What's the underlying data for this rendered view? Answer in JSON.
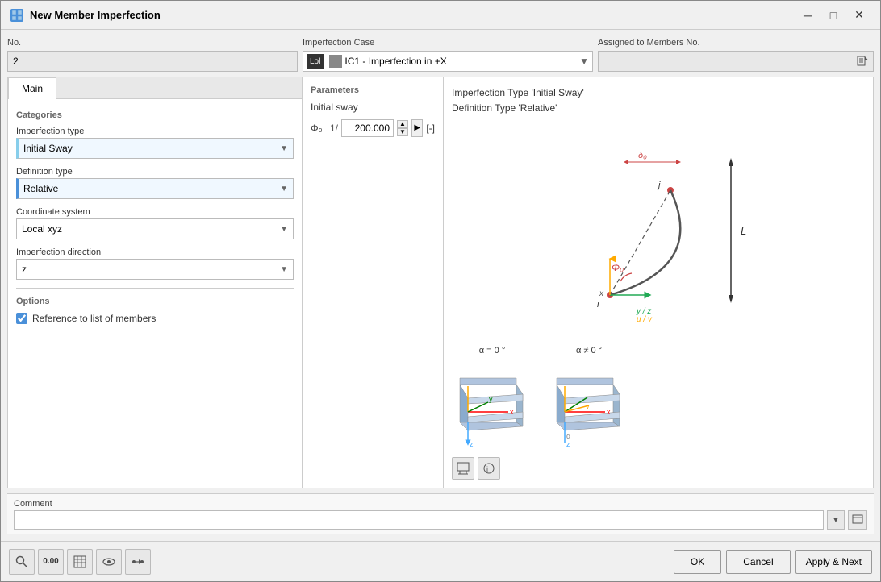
{
  "window": {
    "title": "New Member Imperfection",
    "icon": "★"
  },
  "header": {
    "no_label": "No.",
    "no_value": "2",
    "case_label": "Imperfection Case",
    "case_badge1": "Lol",
    "case_badge2": "IC1 - Imperfection in +X",
    "assigned_label": "Assigned to Members No.",
    "assigned_value": ""
  },
  "tab": {
    "main_label": "Main"
  },
  "categories": {
    "title": "Categories",
    "imperfection_type_label": "Imperfection type",
    "imperfection_type_value": "Initial Sway",
    "definition_type_label": "Definition type",
    "definition_type_value": "Relative",
    "coordinate_system_label": "Coordinate system",
    "coordinate_system_value": "Local xyz",
    "direction_label": "Imperfection direction",
    "direction_value": "z"
  },
  "options": {
    "title": "Options",
    "reference_label": "Reference to list of members",
    "reference_checked": true
  },
  "parameters": {
    "title": "Parameters",
    "subtitle": "Initial sway",
    "phi_symbol": "Φ₀",
    "div_text": "1/",
    "value": "200.000",
    "unit": "[-]"
  },
  "diagram": {
    "type_line1": "Imperfection Type 'Initial Sway'",
    "type_line2": "Definition Type 'Relative'",
    "alpha_zero": "α = 0 °",
    "alpha_nonzero": "α ≠ 0 °"
  },
  "comment": {
    "label": "Comment",
    "value": "",
    "placeholder": ""
  },
  "buttons": {
    "ok": "OK",
    "cancel": "Cancel",
    "apply_next": "Apply & Next"
  },
  "bottom_icons": [
    {
      "name": "search",
      "symbol": "🔍"
    },
    {
      "name": "number",
      "symbol": "0.00"
    },
    {
      "name": "table",
      "symbol": "⊞"
    },
    {
      "name": "eye",
      "symbol": "👁"
    },
    {
      "name": "flow",
      "symbol": "⇄"
    }
  ]
}
